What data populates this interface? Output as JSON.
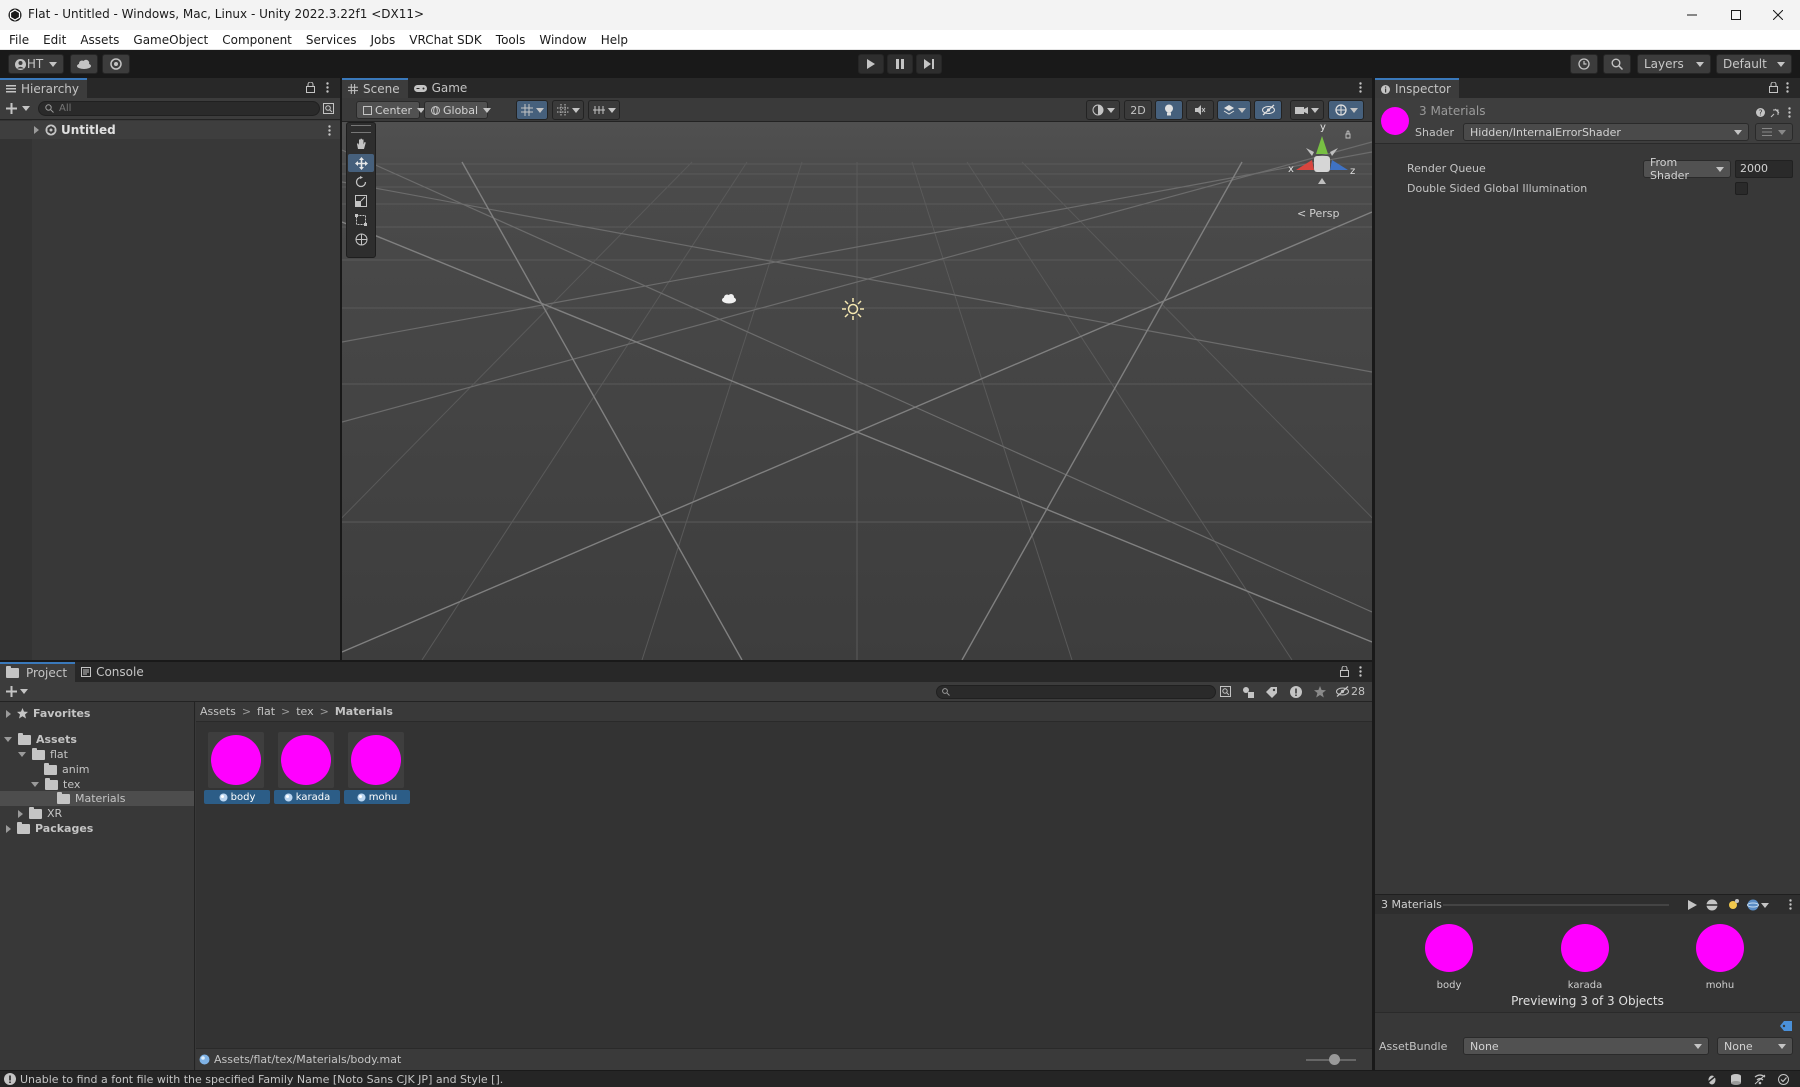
{
  "window": {
    "title": "Flat - Untitled - Windows, Mac, Linux - Unity 2022.3.22f1 <DX11>"
  },
  "menu": [
    "File",
    "Edit",
    "Assets",
    "GameObject",
    "Component",
    "Services",
    "Jobs",
    "VRChat SDK",
    "Tools",
    "Window",
    "Help"
  ],
  "toolbar": {
    "account": "HT",
    "layers": "Layers",
    "layout": "Default"
  },
  "hierarchy": {
    "tab": "Hierarchy",
    "search_placeholder": "All",
    "root": "Untitled"
  },
  "scene": {
    "tab_scene": "Scene",
    "tab_game": "Game",
    "pivot": "Center",
    "space": "Global",
    "btn_2d": "2D",
    "gizmo_y": "y",
    "gizmo_x": "x",
    "gizmo_z": "z",
    "persp": "Persp"
  },
  "inspector": {
    "tab": "Inspector",
    "object_title": "3 Materials",
    "shader_label": "Shader",
    "shader_value": "Hidden/InternalErrorShader",
    "render_queue_label": "Render Queue",
    "render_queue_mode": "From Shader",
    "render_queue_value": "2000",
    "dsgi_label": "Double Sided Global Illumination",
    "preview_title": "3 Materials",
    "preview_items": [
      "body",
      "karada",
      "mohu"
    ],
    "preview_status": "Previewing 3 of 3 Objects",
    "assetbundle_label": "AssetBundle",
    "assetbundle_value": "None",
    "assetbundle_variant": "None"
  },
  "project": {
    "tab_project": "Project",
    "tab_console": "Console",
    "favorites": "Favorites",
    "assets": "Assets",
    "tree": {
      "flat": "flat",
      "anim": "anim",
      "tex": "tex",
      "materials": "Materials",
      "xr": "XR",
      "packages": "Packages"
    },
    "breadcrumb": [
      "Assets",
      "flat",
      "tex",
      "Materials"
    ],
    "hidden_count": "28",
    "assets_grid": [
      "body",
      "karada",
      "mohu"
    ],
    "selected_path": "Assets/flat/tex/Materials/body.mat"
  },
  "status": {
    "message": "Unable to find a font file with the specified Family Name [Noto Sans CJK JP] and Style []."
  },
  "colors": {
    "accent": "#3a79bb",
    "error_material": "#ff00ff",
    "selection": "#2c5d87"
  }
}
